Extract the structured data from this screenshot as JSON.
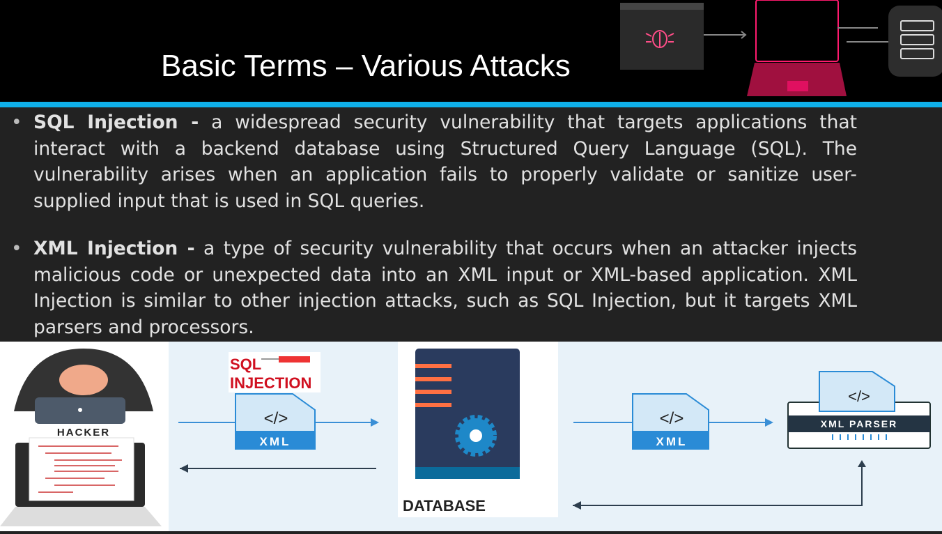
{
  "slide": {
    "title": "Basic Terms – Various Attacks"
  },
  "bullets": [
    {
      "term": "SQL Injection  -",
      "text": " a widespread security vulnerability that targets applications that interact with a backend database using Structured Query Language (SQL). The vulnerability arises when an application fails to properly validate or sanitize user-supplied input that is used in SQL queries."
    },
    {
      "term": "XML Injection -",
      "text": " a type of security vulnerability that occurs when an attacker injects malicious code or unexpected data into an XML input or XML-based application. XML Injection is similar to other injection attacks, such as SQL Injection, but it targets XML parsers and processors."
    }
  ],
  "diagram": {
    "hacker_label": "HACKER",
    "sql_label_1": "SQL",
    "sql_label_2": "INJECTION",
    "xml_label": "XML",
    "code_glyph": "</>",
    "database_label": "DATABASE",
    "parser_label": "XML PARSER"
  },
  "colors": {
    "accent": "#0fb0ea",
    "header": "#000000",
    "body": "#222222",
    "neon": "#ff1a6e",
    "xml_blue": "#2a8bd6"
  }
}
